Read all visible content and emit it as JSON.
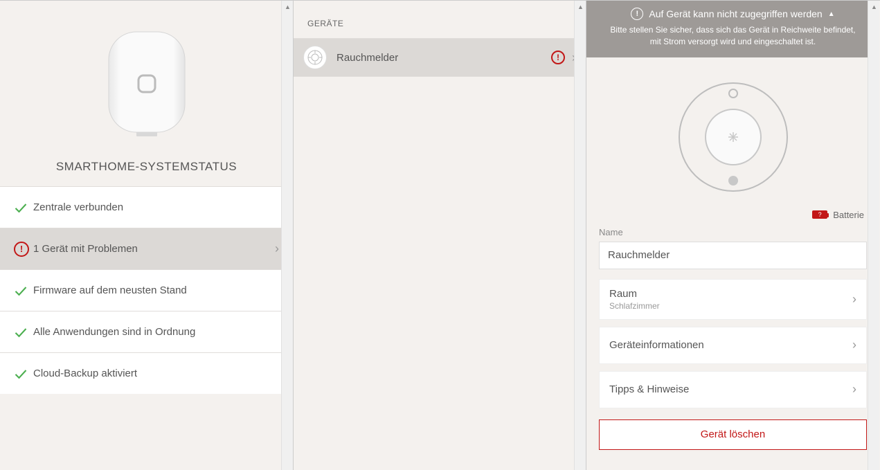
{
  "col1": {
    "title": "SMARTHOME-SYSTEMSTATUS",
    "status": [
      {
        "icon": "check",
        "label": "Zentrale verbunden",
        "nav": false
      },
      {
        "icon": "alert",
        "label": "1 Gerät mit Problemen",
        "nav": true,
        "selected": true
      },
      {
        "icon": "check",
        "label": "Firmware auf dem neusten Stand",
        "nav": false
      },
      {
        "icon": "check",
        "label": "Alle Anwendungen sind in Ordnung",
        "nav": false
      },
      {
        "icon": "check",
        "label": "Cloud-Backup aktiviert",
        "nav": false
      }
    ]
  },
  "col2": {
    "header": "GERÄTE",
    "devices": [
      {
        "name": "Rauchmelder",
        "alert": true
      }
    ]
  },
  "col3": {
    "banner_title": "Auf Gerät kann nicht zugegriffen werden",
    "banner_sub": "Bitte stellen Sie sicher, dass sich das Gerät in Reichweite befindet, mit Strom versorgt wird und eingeschaltet ist.",
    "battery_label": "Batterie",
    "name_label": "Name",
    "name_value": "Rauchmelder",
    "room_label": "Raum",
    "room_value": "Schlafzimmer",
    "info_label": "Geräteinformationen",
    "tips_label": "Tipps & Hinweise",
    "delete_label": "Gerät löschen"
  },
  "colors": {
    "accent_red": "#c21717",
    "ok_green": "#4caf50"
  }
}
